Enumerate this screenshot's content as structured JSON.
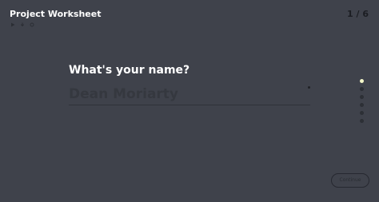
{
  "header": {
    "title": "Project Worksheet",
    "counter": "1 / 6"
  },
  "toolbar": {
    "icons": [
      "play-icon",
      "download-icon",
      "settings-icon"
    ]
  },
  "question": {
    "text": "What's your name?",
    "placeholder": "Dean Moriarty",
    "value": ""
  },
  "progress": {
    "total": 6,
    "current": 1,
    "active_color": "#f4f7c9",
    "inactive_color": "#2c2f35"
  },
  "footer": {
    "continue_label": "Continue"
  },
  "colors": {
    "background": "#3f424b",
    "title": "#ffffff"
  }
}
